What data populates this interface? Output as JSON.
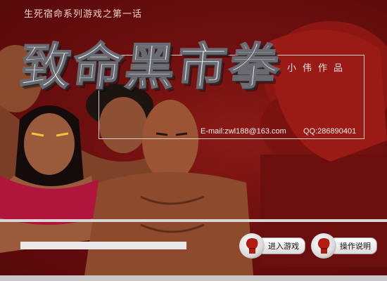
{
  "header": {
    "subtitle": "生死宿命系列游戏之第一话",
    "game_title": "致命黑市拳"
  },
  "credits": {
    "author": "小伟作品",
    "email": "E-mail:zwl188@163.com",
    "qq": "QQ:286890401"
  },
  "loading": {
    "progress": 1.0
  },
  "menu": {
    "enter_label": "进入游戏",
    "help_label": "操作说明"
  },
  "icons": {
    "enter": "boxing-glove-icon",
    "help": "boxing-glove-icon"
  },
  "colors": {
    "background": "#6e0f0f",
    "glove": "#b31a12",
    "title_text": "#e9e9ec"
  }
}
